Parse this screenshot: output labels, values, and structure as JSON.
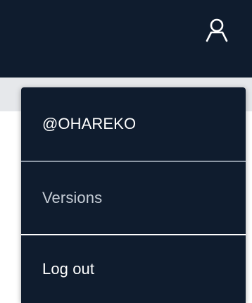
{
  "header": {
    "user_icon": "user-icon",
    "background": "#0f1c2e"
  },
  "user_menu": {
    "username": "@OHAREKO",
    "versions_label": "Versions",
    "logout_label": "Log out"
  },
  "colors": {
    "menu_background": "#0f1c2e",
    "text_primary": "#ffffff",
    "text_muted": "#c6cdd6",
    "subbar": "#e6e8eb"
  }
}
